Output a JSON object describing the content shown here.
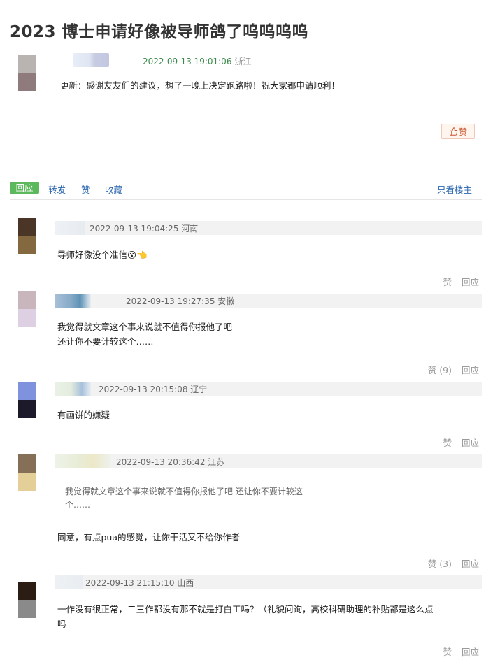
{
  "post": {
    "title": "2023 博士申请好像被导师鸽了呜呜呜呜",
    "datetime": "2022-09-13 19:01:06",
    "location": "浙江",
    "content": "更新：感谢友友们的建议，想了一晚上决定跑路啦！祝大家都申请顺利！",
    "like_label": "赞"
  },
  "actions": {
    "reply": "回应",
    "forward": "转发",
    "like": "赞",
    "collect": "收藏",
    "only_op": "只看楼主"
  },
  "comments": [
    {
      "datetime": "2022-09-13 19:04:25",
      "location": "河南",
      "text_lines": [
        "导师好像没个准信😮👈"
      ],
      "like": "赞",
      "reply": "回应"
    },
    {
      "datetime": "2022-09-13 19:27:35",
      "location": "安徽",
      "text_lines": [
        "我觉得就文章这个事来说就不值得你报他了吧",
        "还让你不要计较这个……"
      ],
      "like": "赞 (9)",
      "reply": "回应"
    },
    {
      "datetime": "2022-09-13 20:15:08",
      "location": "辽宁",
      "text_lines": [
        "有画饼的嫌疑"
      ],
      "like": "赞",
      "reply": "回应"
    },
    {
      "datetime": "2022-09-13 20:36:42",
      "location": "江苏",
      "quote_lines": [
        "我觉得就文章这个事来说就不值得你报他了吧 还让你不要计较这",
        "个……"
      ],
      "text_lines": [
        "同意，有点pua的感觉，让你干活又不给你作者"
      ],
      "like": "赞 (3)",
      "reply": "回应"
    },
    {
      "datetime": "2022-09-13 21:15:10",
      "location": "山西",
      "text_lines": [
        "一作没有很正常，二三作都没有那不就是打白工吗？（礼貌问询，高校科研助理的补贴都是这么点",
        "吗"
      ],
      "like": "赞",
      "reply": "回应"
    }
  ],
  "colors": {
    "accent_green": "#5cb85c",
    "link_blue": "#2c67b0",
    "like_orange": "#c8552e",
    "meta_green": "#3b8a4a"
  }
}
